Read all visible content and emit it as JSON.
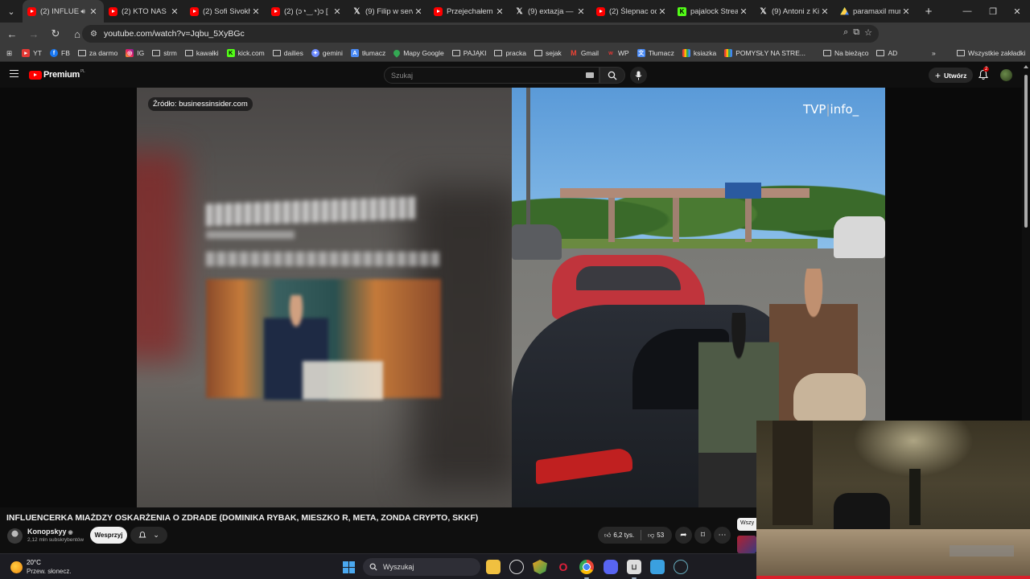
{
  "browser": {
    "tabs": [
      {
        "title": "(2) INFLUE",
        "icon": "youtube-icon",
        "active": true
      },
      {
        "title": "(2) KTO NAS N",
        "icon": "youtube-icon"
      },
      {
        "title": "(2) Sofi Sivokh",
        "icon": "youtube-icon"
      },
      {
        "title": "(2) (ɔ◔‿◔)ɔ [",
        "icon": "youtube-icon"
      },
      {
        "title": "(9) Filip w serw",
        "icon": "x-icon"
      },
      {
        "title": "Przejechałem P",
        "icon": "youtube-icon"
      },
      {
        "title": "(9) extazja — V",
        "icon": "x-icon"
      },
      {
        "title": "(2) Ślepnac od",
        "icon": "youtube-icon"
      },
      {
        "title": "pajalock Strean",
        "icon": "kick-icon"
      },
      {
        "title": "(9) Antoni z Kij",
        "icon": "x-icon"
      },
      {
        "title": "paramaxil mur",
        "icon": "drive-icon"
      }
    ],
    "url": "youtube.com/watch?v=Jqbu_5XyBGc",
    "bookmarks": [
      {
        "label": "YT",
        "icon": "youtube-icon"
      },
      {
        "label": "FB",
        "icon": "facebook-icon"
      },
      {
        "label": "za darmo",
        "icon": "folder-icon"
      },
      {
        "label": "IG",
        "icon": "instagram-icon"
      },
      {
        "label": "strm",
        "icon": "folder-icon"
      },
      {
        "label": "kawałki",
        "icon": "folder-icon"
      },
      {
        "label": "kick.com",
        "icon": "kick-icon"
      },
      {
        "label": "dailies",
        "icon": "folder-icon"
      },
      {
        "label": "gemini",
        "icon": "gemini-icon"
      },
      {
        "label": "tłumacz",
        "icon": "translate-icon"
      },
      {
        "label": "Mapy Google",
        "icon": "maps-icon"
      },
      {
        "label": "PAJĄKI",
        "icon": "folder-icon"
      },
      {
        "label": "pracka",
        "icon": "folder-icon"
      },
      {
        "label": "sejak",
        "icon": "folder-icon"
      },
      {
        "label": "Gmail",
        "icon": "gmail-icon"
      },
      {
        "label": "WP",
        "icon": "wp-icon"
      },
      {
        "label": "Tłumacz",
        "icon": "translate-icon"
      },
      {
        "label": "ksiazka",
        "icon": "book-icon"
      },
      {
        "label": "POMYSŁY NA STRE...",
        "icon": "ideas-icon"
      },
      {
        "label": "Na bieżąco",
        "icon": "folder-icon"
      },
      {
        "label": "AD",
        "icon": "folder-icon"
      }
    ],
    "all_bookmarks": "Wszystkie zakładki"
  },
  "youtube": {
    "logo_text": "Premium",
    "logo_sup": "PL",
    "search_placeholder": "Szukaj",
    "create_label": "Utwórz",
    "notif_count": "2",
    "video": {
      "source_tag": "Źródło: businessinsider.com",
      "watermark_tvp": "TVP",
      "watermark_sep": "|",
      "watermark_info": "info_"
    },
    "title": "INFLUENCERKA MIAŻDZY OSKARŻENIA O ZDRADE (DOMINIKA RYBAK, MIESZKO R, META, ZONDA CRYPTO, SKKF)",
    "channel": "Konopskyy",
    "verified": "◉",
    "subscribers": "2,12 mln subskrybentów",
    "support_label": "Wesprzyj",
    "likes": "6,2 tys.",
    "dislikes": "53",
    "side_chip": "Wszy"
  },
  "taskbar": {
    "temp": "20°C",
    "weather": "Przew. słonecz.",
    "search": "Wyszukaj"
  },
  "colors": {
    "youtube_red": "#ff0000",
    "page_bg": "#0f0f0f",
    "browser_chrome": "#3a3a3a"
  }
}
